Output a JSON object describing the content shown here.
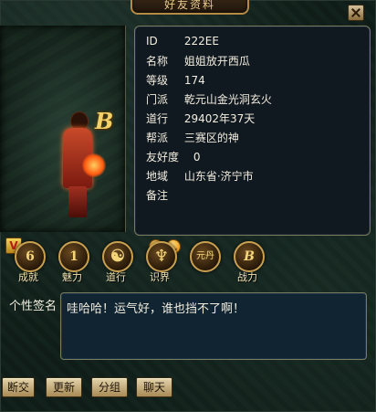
{
  "window": {
    "title": "好友资料"
  },
  "profile": {
    "rows": [
      {
        "key": "ID",
        "value": "222EE"
      },
      {
        "key": "名称",
        "value": "姐姐放开西瓜"
      },
      {
        "key": "等级",
        "value": "174"
      },
      {
        "key": "门派",
        "value": "乾元山金光洞玄火"
      },
      {
        "key": "道行",
        "value": "29402年37天"
      },
      {
        "key": "帮派",
        "value": "三赛区的神"
      },
      {
        "key": "友好度",
        "value": "0"
      },
      {
        "key": "地域",
        "value": "山东省·济宁市"
      },
      {
        "key": "备注",
        "value": ""
      }
    ]
  },
  "portrait": {
    "badge_b": "B",
    "badge_v": "V"
  },
  "icons": [
    {
      "glyph": "6",
      "label": "成就",
      "name": "achievement-icon"
    },
    {
      "glyph": "1",
      "label": "魅力",
      "name": "charm-icon"
    },
    {
      "glyph": "☯",
      "label": "道行",
      "name": "taoism-icon"
    },
    {
      "glyph": "♆",
      "label": "识界",
      "name": "realm-icon"
    },
    {
      "glyph": "元丹",
      "label": "元丹",
      "name": "elixir-icon"
    },
    {
      "glyph": "B",
      "label": "战力",
      "name": "combat-power-icon"
    }
  ],
  "signature": {
    "label": "个性签名",
    "text": "哇哈哈！运气好，谁也挡不了啊！"
  },
  "buttons": {
    "unfriend": "断交",
    "refresh": "更新",
    "group": "分组",
    "chat": "聊天"
  },
  "colors": {
    "gold": "#c9a050",
    "panel": "#101820",
    "text": "#f3eedf"
  }
}
